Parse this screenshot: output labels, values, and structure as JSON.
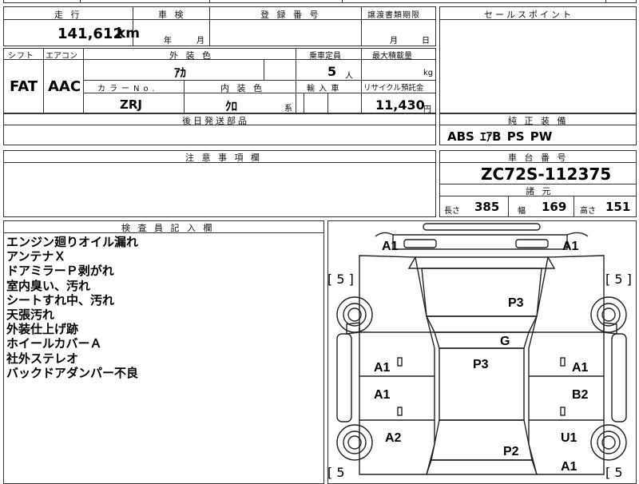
{
  "top_fragments": [
    "",
    "",
    ""
  ],
  "mileage": {
    "label": "走 行",
    "value": "141,612",
    "unit": "km"
  },
  "inspection": {
    "label": "車 検",
    "year_unit": "年",
    "month_unit": "月"
  },
  "registration": {
    "label": "登 録 番 号",
    "value": ""
  },
  "transfer_deadline": {
    "label": "譲渡書類期限",
    "month_unit": "月",
    "day_unit": "日"
  },
  "sales_point": {
    "label": "セールスポイント",
    "value": ""
  },
  "shift": {
    "label": "シフト",
    "value": "FAT"
  },
  "aircon": {
    "label": "エアコン",
    "value": "AAC"
  },
  "exterior_color": {
    "label": "外 装 色",
    "value": "ｱｶ"
  },
  "capacity": {
    "label": "乗車定員",
    "value": "5",
    "unit": "人"
  },
  "max_load": {
    "label": "最大積載量",
    "unit": "kg"
  },
  "color_no": {
    "label": "カラーNo.",
    "value": "ZRJ"
  },
  "interior_color": {
    "label": "内 装 色",
    "value": "ｸﾛ",
    "suffix": "系"
  },
  "import_car": {
    "label": "輸 入 車"
  },
  "recycle_fee": {
    "label": "リサイクル預託金",
    "value": "11,430",
    "unit": "円"
  },
  "later_parts": {
    "label": "後日発送部品"
  },
  "genuine_equipment": {
    "label": "純 正 装 備",
    "value": "ABS ｴｱB PS PW"
  },
  "caution": {
    "label": "注 意 事 項 欄"
  },
  "chassis": {
    "label": "車 台 番 号",
    "value": "ZC72S-112375"
  },
  "specs": {
    "label": "諸 元",
    "length_label": "長さ",
    "length": "385",
    "width_label": "幅",
    "width": "169",
    "height_label": "高さ",
    "height": "151"
  },
  "inspector_notes": {
    "label": "検 査 員 記 入 欄",
    "lines": [
      "エンジン廻りオイル漏れ",
      "アンテナＸ",
      "ドアミラーＰ剥がれ",
      "室内臭い、汚れ",
      "シートすれ中、汚れ",
      "天張汚れ",
      "外装仕上げ跡",
      "ホイールカバーＡ",
      "社外ステレオ",
      "バックドアダンパー不良"
    ]
  },
  "diagram": {
    "tires": [
      "[ 5 ]",
      "[ 5 ]",
      "[ 5",
      "[ 5"
    ],
    "marks": {
      "front_left": "A1",
      "front_right": "A1",
      "hood": "P3",
      "windshield": "G",
      "roof": "P3",
      "door_fl": "A1",
      "door_fr": "A1",
      "door_rl": "A1",
      "door_rr": "B2",
      "quarter_l": "A2",
      "quarter_r": "U1",
      "back_door": "P2",
      "rear_r": "A1"
    }
  }
}
